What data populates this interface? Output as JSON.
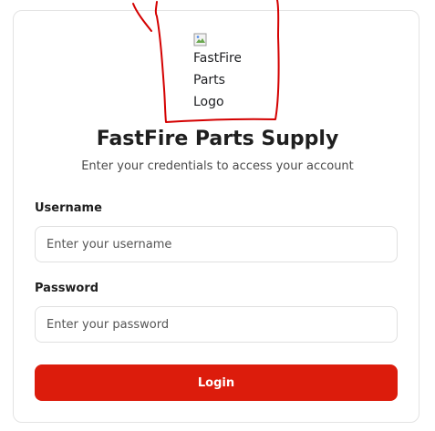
{
  "logo": {
    "alt_lines": [
      "FastFire",
      "Parts",
      "Logo"
    ]
  },
  "header": {
    "title": "FastFire Parts Supply",
    "subtitle": "Enter your credentials to access your account"
  },
  "form": {
    "username_label": "Username",
    "username_placeholder": "Enter your username",
    "password_label": "Password",
    "password_placeholder": "Enter your password",
    "login_label": "Login"
  },
  "colors": {
    "primary": "#dc1c0c",
    "annotation": "#d40000"
  }
}
